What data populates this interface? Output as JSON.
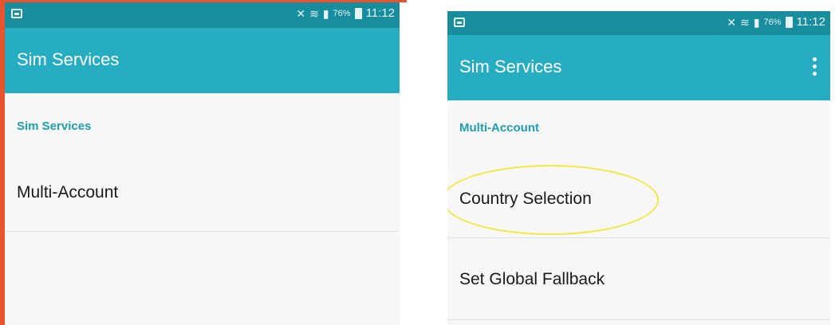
{
  "status_bar": {
    "battery_percent": "76%",
    "time": "11:12",
    "icons": [
      "screenshot-icon",
      "mute-icon",
      "wifi-icon",
      "signal-icon",
      "battery-icon"
    ]
  },
  "screen_a": {
    "app_title": "Sim Services",
    "section_header": "Sim Services",
    "items": [
      {
        "label": "Multi-Account"
      }
    ]
  },
  "screen_b": {
    "app_title": "Sim Services",
    "section_header": "Multi-Account",
    "items": [
      {
        "label": "Country Selection"
      },
      {
        "label": "Set Global Fallback"
      }
    ]
  },
  "colors": {
    "status_bar": "#178d9e",
    "app_bar": "#27adc1",
    "section_header": "#1b9fb5",
    "highlight": "#f2e93c",
    "frame_border": "#e8542e"
  }
}
